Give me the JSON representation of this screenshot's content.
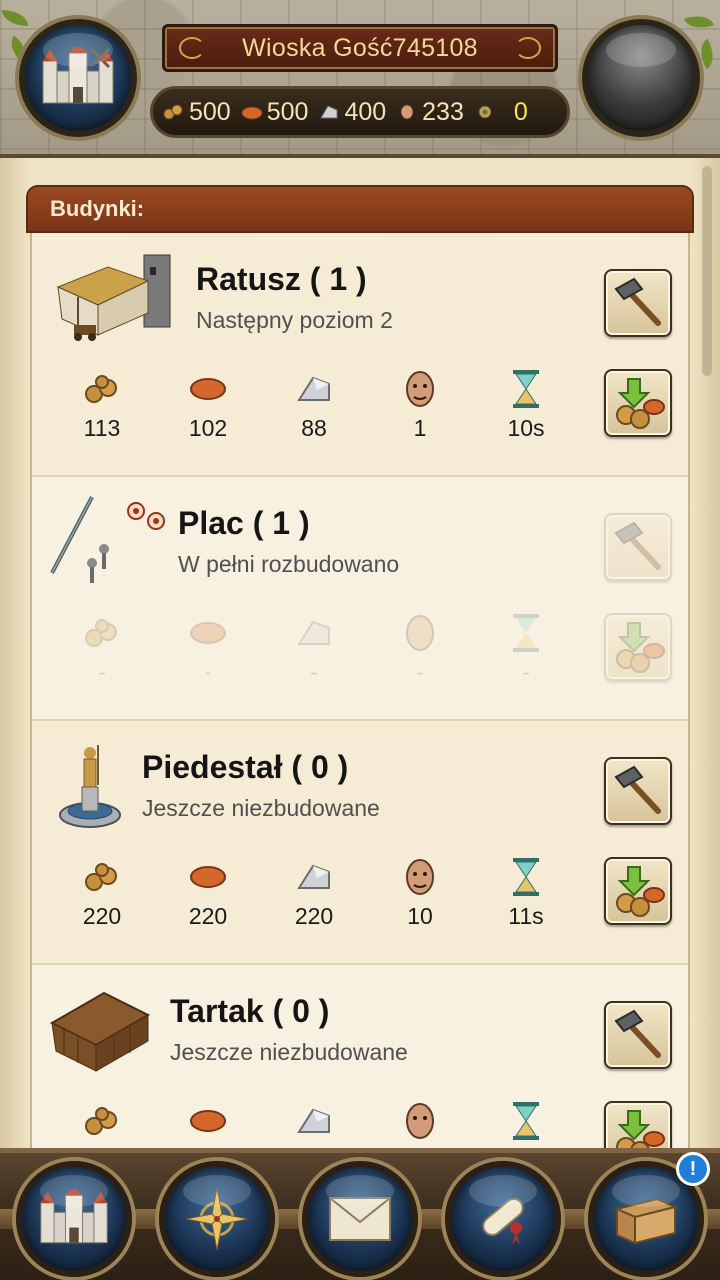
{
  "header": {
    "village_name": "Wioska Gość745108",
    "resources": [
      {
        "name": "wood",
        "icon": "wood-icon",
        "value": "500"
      },
      {
        "name": "clay",
        "icon": "clay-icon",
        "value": "500"
      },
      {
        "name": "iron",
        "icon": "iron-icon",
        "value": "400"
      },
      {
        "name": "population",
        "icon": "population-icon",
        "value": "233"
      },
      {
        "name": "gold",
        "icon": "gold-icon",
        "value": "0"
      }
    ]
  },
  "section": {
    "title": "Budynki:"
  },
  "buildings": [
    {
      "name": "Ratusz ( 1 )",
      "status": "Następny poziom 2",
      "costs": [
        "113",
        "102",
        "88",
        "1",
        "10s"
      ],
      "enabled": true
    },
    {
      "name": "Plac ( 1 )",
      "status": "W pełni rozbudowano",
      "costs": [
        "-",
        "-",
        "-",
        "-",
        "-"
      ],
      "enabled": false
    },
    {
      "name": "Piedestał ( 0 )",
      "status": "Jeszcze niezbudowane",
      "costs": [
        "220",
        "220",
        "220",
        "10",
        "11s"
      ],
      "enabled": true
    },
    {
      "name": "Tartak ( 0 )",
      "status": "Jeszcze niezbudowane",
      "costs": [
        "",
        "",
        "",
        "",
        ""
      ],
      "enabled": true
    }
  ],
  "bottom_nav": {
    "items": [
      "village",
      "map",
      "messages",
      "reports",
      "chest"
    ],
    "chest_badge": "!"
  },
  "colors": {
    "banner": "#5a2513",
    "section_header": "#8a3d1a",
    "gold_text": "#f5e74a",
    "badge": "#1f7fd6"
  }
}
